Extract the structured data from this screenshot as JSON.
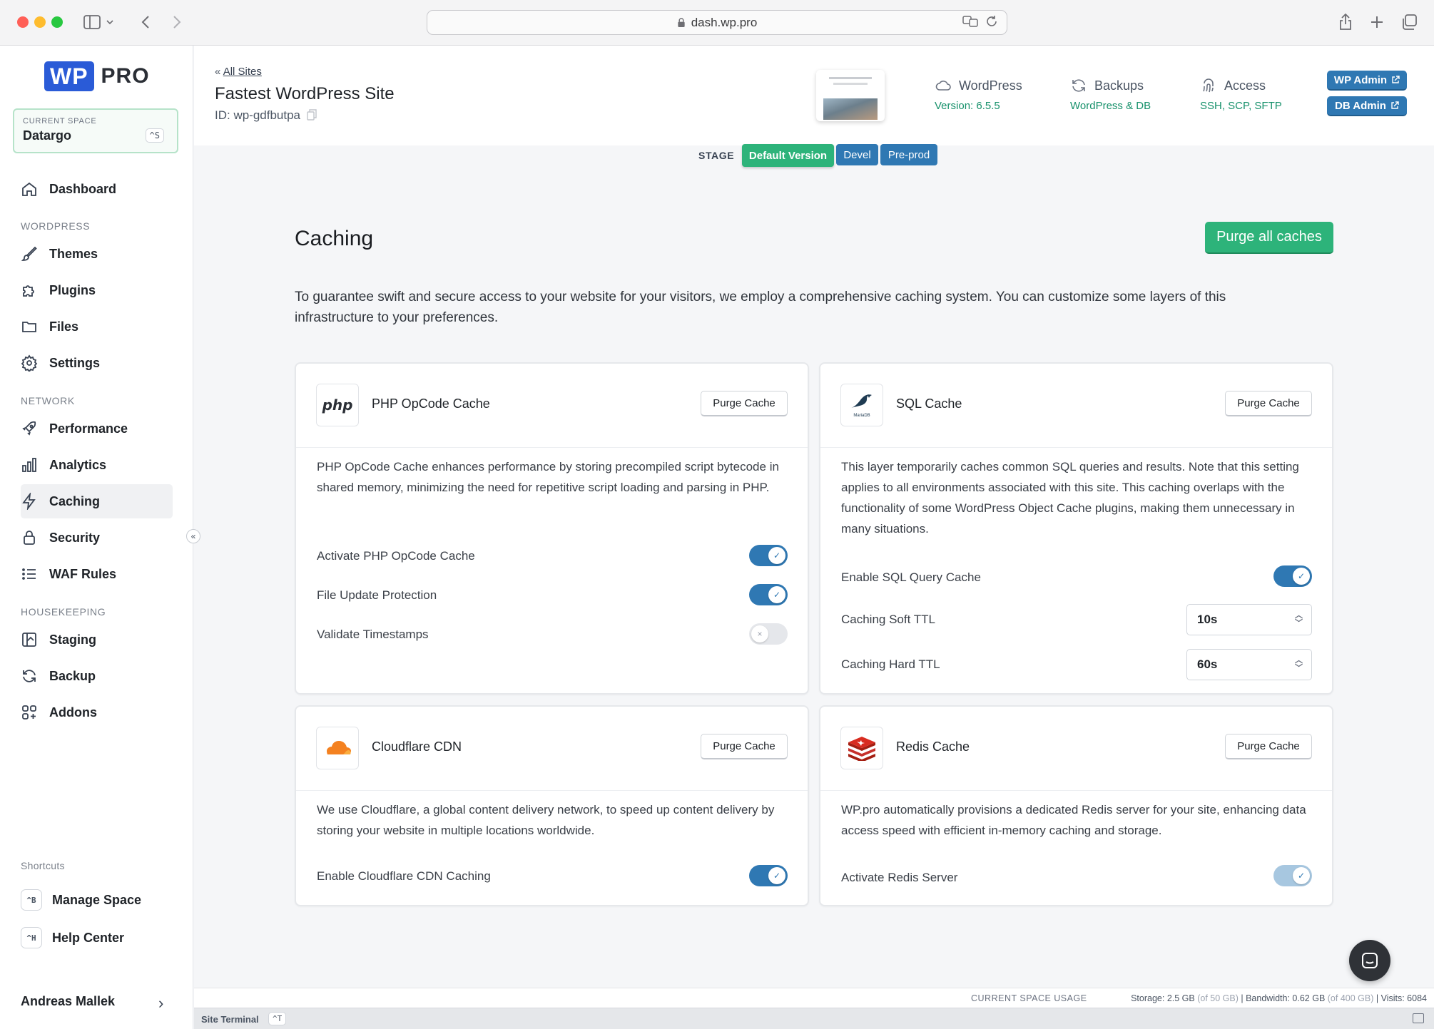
{
  "browser": {
    "url": "dash.wp.pro"
  },
  "brand": {
    "logo_wp": "WP",
    "logo_pro": "PRO"
  },
  "space": {
    "label": "CURRENT SPACE",
    "name": "Datargo",
    "shortcut": "^S"
  },
  "nav": {
    "dashboard": "Dashboard",
    "wordpress_section": "WORDPRESS",
    "themes": "Themes",
    "plugins": "Plugins",
    "files": "Files",
    "settings": "Settings",
    "network_section": "NETWORK",
    "performance": "Performance",
    "analytics": "Analytics",
    "caching": "Caching",
    "security": "Security",
    "waf_rules": "WAF Rules",
    "housekeeping_section": "HOUSEKEEPING",
    "staging": "Staging",
    "backup": "Backup",
    "addons": "Addons"
  },
  "shortcuts": {
    "title": "Shortcuts",
    "items": [
      {
        "key": "^B",
        "label": "Manage Space"
      },
      {
        "key": "^H",
        "label": "Help Center"
      }
    ]
  },
  "user": {
    "name": "Andreas Mallek"
  },
  "header": {
    "crumb": "All Sites",
    "site_title": "Fastest WordPress Site",
    "site_id": "ID: wp-gdfbutpa",
    "wordpress": {
      "title": "WordPress",
      "sub": "Version: 6.5.5"
    },
    "backups": {
      "title": "Backups",
      "sub": "WordPress & DB"
    },
    "access": {
      "title": "Access",
      "sub": "SSH, SCP, SFTP"
    },
    "wp_admin": "WP Admin",
    "db_admin": "DB Admin",
    "stage_label": "STAGE",
    "stages": [
      "Default Version",
      "Devel",
      "Pre-prod"
    ]
  },
  "main": {
    "title": "Caching",
    "purge_all": "Purge all caches",
    "intro": "To guarantee swift and secure access to your website for your visitors, we employ a comprehensive caching system. You can customize some layers of this infrastructure to your preferences."
  },
  "cards": {
    "php": {
      "icon_text": "php",
      "title": "PHP OpCode Cache",
      "purge": "Purge Cache",
      "desc": "PHP OpCode Cache enhances performance by storing precompiled script bytecode in shared memory, minimizing the need for repetitive script loading and parsing in PHP.",
      "rows": [
        {
          "label": "Activate PHP OpCode Cache",
          "enabled": true
        },
        {
          "label": "File Update Protection",
          "enabled": true
        },
        {
          "label": "Validate Timestamps",
          "enabled": false
        }
      ]
    },
    "sql": {
      "icon_text": "MariaDB",
      "title": "SQL Cache",
      "purge": "Purge Cache",
      "desc": "This layer temporarily caches common SQL queries and results. Note that this setting applies to all environments associated with this site. This caching overlaps with the functionality of some WordPress Object Cache plugins, making them unnecessary in many situations.",
      "enable_label": "Enable SQL Query Cache",
      "enabled": true,
      "soft_ttl_label": "Caching Soft TTL",
      "soft_ttl": "10s",
      "hard_ttl_label": "Caching Hard TTL",
      "hard_ttl": "60s"
    },
    "cloudflare": {
      "title": "Cloudflare CDN",
      "purge": "Purge Cache",
      "desc": "We use Cloudflare, a global content delivery network, to speed up content delivery by storing your website in multiple locations worldwide.",
      "enable_label": "Enable Cloudflare CDN Caching",
      "enabled": true
    },
    "redis": {
      "title": "Redis Cache",
      "purge": "Purge Cache",
      "desc": "WP.pro automatically provisions a dedicated Redis server for your site, enhancing data access speed with efficient in-memory caching and storage.",
      "enable_label": "Activate Redis Server",
      "enabled": true
    }
  },
  "footer": {
    "usage_label": "CURRENT SPACE USAGE",
    "storage": "Storage: 2.5 GB",
    "storage_of": "(of 50 GB)",
    "bandwidth": "Bandwidth: 0.62 GB",
    "bandwidth_of": "(of 400 GB)",
    "visits": "Visits: 6084",
    "terminal": "Site Terminal",
    "terminal_key": "^T"
  },
  "colors": {
    "accent_green": "#2db37a",
    "accent_blue": "#2f78b3",
    "brand_blue": "#2a5bd7"
  }
}
